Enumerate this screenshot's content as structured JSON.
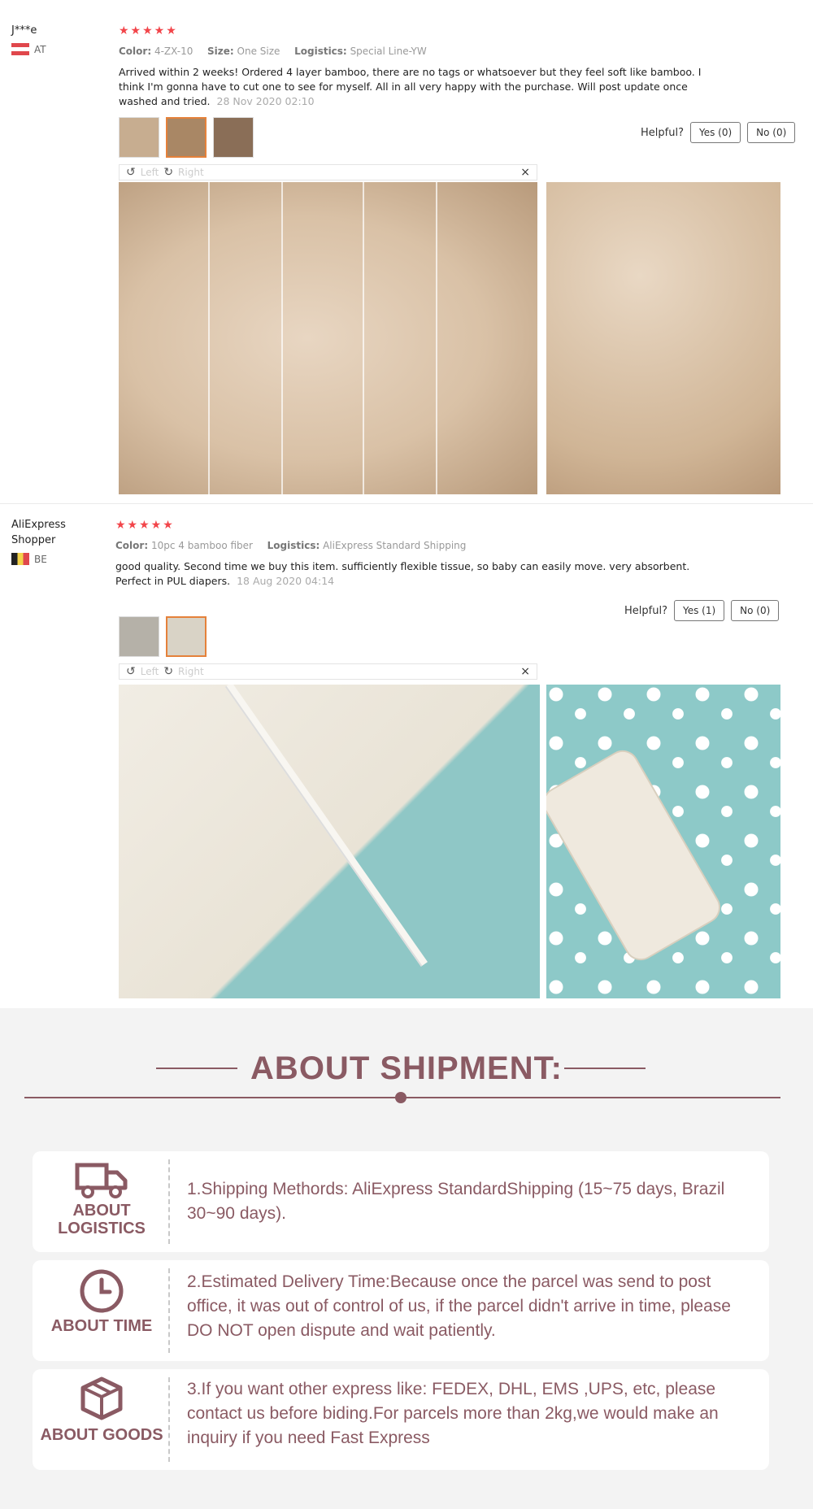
{
  "reviews": [
    {
      "name": "J***e",
      "country": "AT",
      "stars": "★★★★★",
      "color_label": "Color:",
      "color": "4-ZX-10",
      "size_label": "Size:",
      "size": "One Size",
      "logistics_label": "Logistics:",
      "logistics": "Special Line-YW",
      "text": "Arrived within 2 weeks! Ordered 4 layer bamboo, there are no tags or whatsoever but they feel soft like bamboo. I think I'm gonna have to cut one to see for myself. All in all very happy with the purchase. Will post update once washed and tried.",
      "date": "28 Nov 2020 02:10",
      "helpful_label": "Helpful?",
      "yes": "Yes (0)",
      "no": "No (0)",
      "viewer": {
        "left": "Left",
        "right": "Right",
        "close": "×"
      }
    },
    {
      "name": "AliExpress Shopper",
      "country": "BE",
      "stars": "★★★★★",
      "color_label": "Color:",
      "color": "10pc 4 bamboo fiber",
      "logistics_label": "Logistics:",
      "logistics": "AliExpress Standard Shipping",
      "text": "good quality. Second time we buy this item. sufficiently flexible tissue, so baby can easily move. very absorbent. Perfect in PUL diapers.",
      "date": "18 Aug 2020 04:14",
      "helpful_label": "Helpful?",
      "yes": "Yes (1)",
      "no": "No (0)",
      "viewer": {
        "left": "Left",
        "right": "Right",
        "close": "×"
      }
    }
  ],
  "shipment": {
    "title": "ABOUT SHIPMENT:",
    "accent_color": "#8a5a63",
    "cards": [
      {
        "icon": "truck-icon",
        "label": "ABOUT LOGISTICS",
        "text": "1.Shipping Methords: AliExpress StandardShipping (15~75 days, Brazil 30~90 days)."
      },
      {
        "icon": "clock-icon",
        "label": "ABOUT TIME",
        "text": "2.Estimated Delivery Time:Because once the parcel was send to post office, it was out of control of us, if the parcel didn't arrive in time, please DO NOT open dispute and wait patiently."
      },
      {
        "icon": "box-icon",
        "label": "ABOUT GOODS",
        "text": "3.If you want other express like: FEDEX, DHL, EMS ,UPS, etc, please contact us before biding.For parcels more than 2kg,we would make an inquiry if you need Fast Express"
      }
    ]
  }
}
